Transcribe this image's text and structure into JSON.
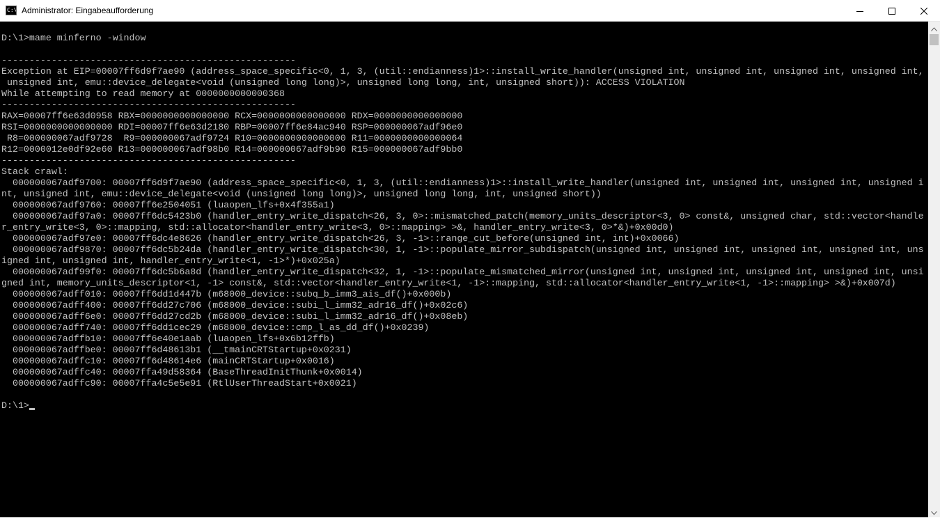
{
  "window": {
    "title": "Administrator: Eingabeaufforderung",
    "icon_label": "C:\\",
    "icon": "cmd-console-icon",
    "buttons": {
      "minimize_icon": "minimize-icon",
      "maximize_icon": "maximize-icon",
      "close_icon": "close-icon"
    }
  },
  "colors": {
    "console_background": "#000000",
    "console_text": "#c0c0c0",
    "titlebar_background": "#ffffff",
    "scrollbar_track": "#f0f0f0",
    "scrollbar_thumb": "#c1c1c1"
  },
  "console": {
    "lines": [
      "",
      "D:\\1>mame minferno -window",
      "",
      "-----------------------------------------------------",
      "Exception at EIP=00007ff6d9f7ae90 (address_space_specific<0, 1, 3, (util::endianness)1>::install_write_handler(unsigned int, unsigned int, unsigned int, unsigned int,",
      " unsigned int, emu::device_delegate<void (unsigned long long)>, unsigned long long, int, unsigned short)): ACCESS VIOLATION",
      "While attempting to read memory at 0000000000000368",
      "-----------------------------------------------------",
      "RAX=00007ff6e63d0958 RBX=0000000000000000 RCX=0000000000000000 RDX=0000000000000000",
      "RSI=0000000000000000 RDI=00007ff6e63d2180 RBP=00007ff6e84ac940 RSP=000000067adf96e0",
      " R8=000000067adf9728  R9=000000067adf9724 R10=0000000000000000 R11=0000000000000064",
      "R12=0000012e0df92e60 R13=000000067adf98b0 R14=000000067adf9b90 R15=000000067adf9bb0",
      "-----------------------------------------------------",
      "Stack crawl:",
      "  000000067adf9700: 00007ff6d9f7ae90 (address_space_specific<0, 1, 3, (util::endianness)1>::install_write_handler(unsigned int, unsigned int, unsigned int, unsigned i",
      "nt, unsigned int, emu::device_delegate<void (unsigned long long)>, unsigned long long, int, unsigned short))",
      "  000000067adf9760: 00007ff6e2504051 (luaopen_lfs+0x4f355a1)",
      "  000000067adf97a0: 00007ff6dc5423b0 (handler_entry_write_dispatch<26, 3, 0>::mismatched_patch(memory_units_descriptor<3, 0> const&, unsigned char, std::vector<handle",
      "r_entry_write<3, 0>::mapping, std::allocator<handler_entry_write<3, 0>::mapping> >&, handler_entry_write<3, 0>*&)+0x00d0)",
      "  000000067adf97e0: 00007ff6dc4e8626 (handler_entry_write_dispatch<26, 3, -1>::range_cut_before(unsigned int, int)+0x0066)",
      "  000000067adf9870: 00007ff6dc5b24da (handler_entry_write_dispatch<30, 1, -1>::populate_mirror_subdispatch(unsigned int, unsigned int, unsigned int, unsigned int, uns",
      "igned int, unsigned int, handler_entry_write<1, -1>*)+0x025a)",
      "  000000067adf99f0: 00007ff6dc5b6a8d (handler_entry_write_dispatch<32, 1, -1>::populate_mismatched_mirror(unsigned int, unsigned int, unsigned int, unsigned int, unsi",
      "gned int, memory_units_descriptor<1, -1> const&, std::vector<handler_entry_write<1, -1>::mapping, std::allocator<handler_entry_write<1, -1>::mapping> >&)+0x007d)",
      "  000000067adff010: 00007ff6dd1d447b (m68000_device::subq_b_imm3_ais_df()+0x000b)",
      "  000000067adff400: 00007ff6dd27c706 (m68000_device::subi_l_imm32_adr16_df()+0x02c6)",
      "  000000067adff6e0: 00007ff6dd27cd2b (m68000_device::subi_l_imm32_adr16_df()+0x08eb)",
      "  000000067adff740: 00007ff6dd1cec29 (m68000_device::cmp_l_as_dd_df()+0x0239)",
      "  000000067adffb10: 00007ff6e40e1aab (luaopen_lfs+0x6b12ffb)",
      "  000000067adffbe0: 00007ff6d48613b1 (__tmainCRTStartup+0x0231)",
      "  000000067adffc10: 00007ff6d48614e6 (mainCRTStartup+0x0016)",
      "  000000067adffc40: 00007ffa49d58364 (BaseThreadInitThunk+0x0014)",
      "  000000067adffc90: 00007ffa4c5e5e91 (RtlUserThreadStart+0x0021)",
      ""
    ],
    "prompt": "D:\\1>"
  },
  "scrollbar": {
    "up_icon": "scroll-up-arrow-icon",
    "down_icon": "scroll-down-arrow-icon"
  }
}
